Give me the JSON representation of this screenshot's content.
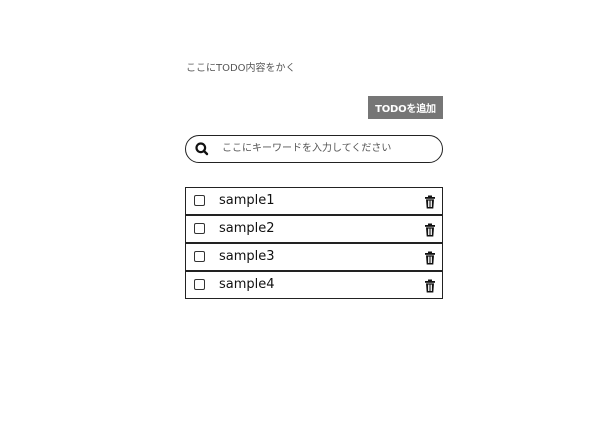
{
  "todo_input": {
    "placeholder": "ここにTODO内容をかく",
    "value": ""
  },
  "add_button": {
    "label": "TODOを追加"
  },
  "search": {
    "icon": "search-icon",
    "placeholder": "ここにキーワードを入力してください",
    "value": ""
  },
  "todos": [
    {
      "label": "sample1",
      "checked": false,
      "delete_icon": "trash-icon"
    },
    {
      "label": "sample2",
      "checked": false,
      "delete_icon": "trash-icon"
    },
    {
      "label": "sample3",
      "checked": false,
      "delete_icon": "trash-icon"
    },
    {
      "label": "sample4",
      "checked": false,
      "delete_icon": "trash-icon"
    }
  ],
  "colors": {
    "add_button_bg": "#767676",
    "border": "#222222"
  }
}
